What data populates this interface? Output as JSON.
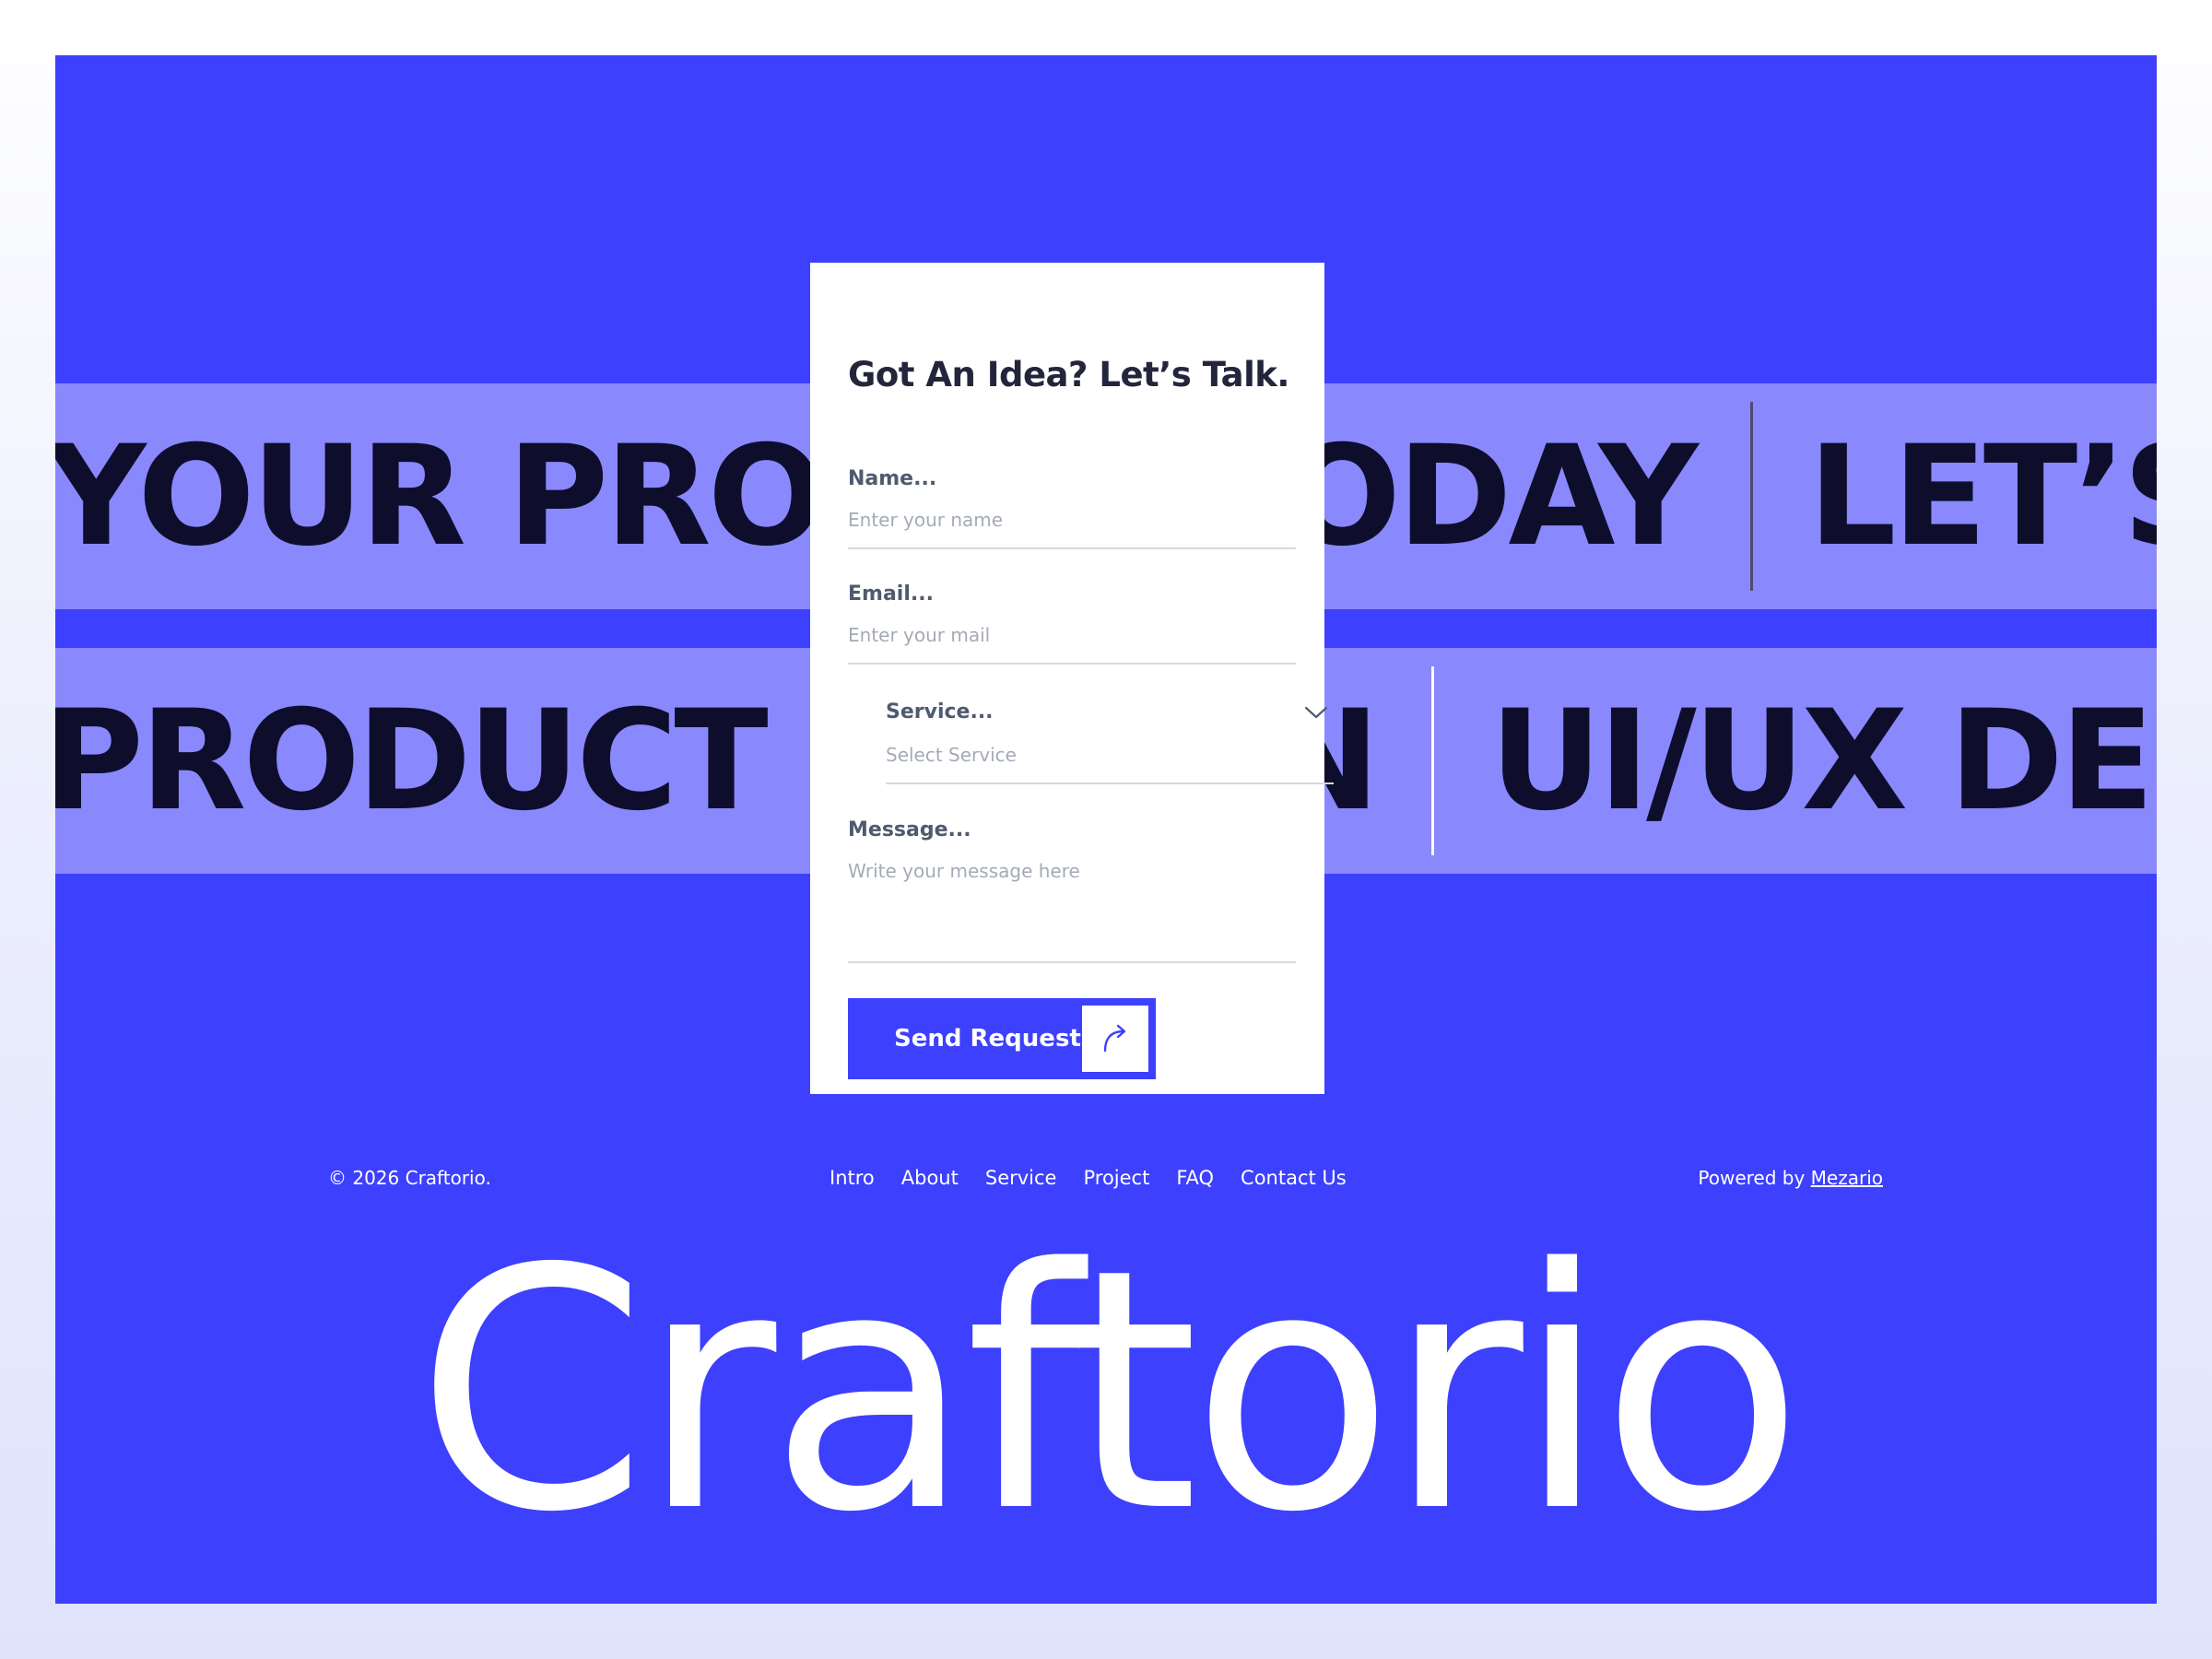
{
  "marquee": {
    "row1": {
      "text1": "YOUR PROJECT TODAY",
      "text2": "LET’S"
    },
    "row2": {
      "text1": "PRODUCT DESIGN",
      "text2": "UI/UX DES"
    }
  },
  "form": {
    "title": "Got An Idea? Let’s Talk.",
    "name": {
      "label": "Name...",
      "placeholder": "Enter your name"
    },
    "email": {
      "label": "Email...",
      "placeholder": "Enter your mail"
    },
    "service": {
      "label": "Service...",
      "selected": "Select Service"
    },
    "message": {
      "label": "Message...",
      "placeholder": "Write your message here"
    },
    "submit_label": "Send Request"
  },
  "footer": {
    "copyright": "© 2026 Craftorio.",
    "nav": [
      "Intro",
      "About",
      "Service",
      "Project",
      "FAQ",
      "Contact Us"
    ],
    "powered_prefix": "Powered by",
    "powered_link": "Mezario"
  },
  "brand": {
    "wordmark": "Craftorio"
  },
  "colors": {
    "accent": "#3d40fd",
    "band": "#8a88fd",
    "band_text": "#0e0e2c",
    "card": "#ffffff"
  },
  "icons": {
    "chevron": "chevron-down-icon",
    "send": "curved-arrow-icon"
  }
}
